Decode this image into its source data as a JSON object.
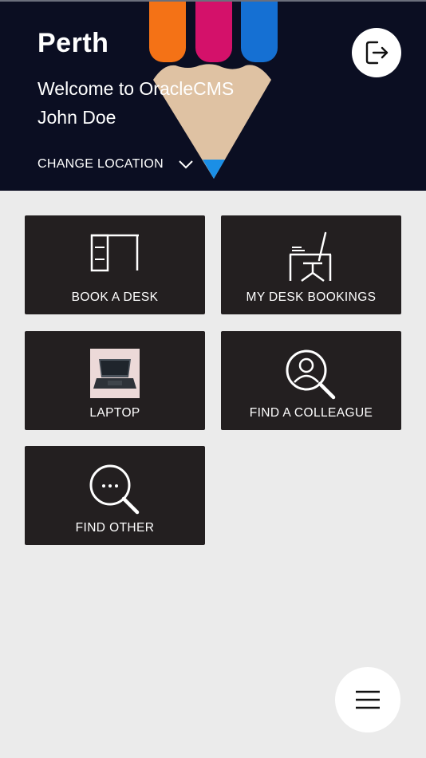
{
  "header": {
    "city": "Perth",
    "welcome": "Welcome to OracleCMS",
    "user_name": "John Doe",
    "change_location_label": "CHANGE LOCATION",
    "background_colors": {
      "dark": "#0b0e22",
      "orange": "#f47216",
      "magenta": "#d4116a",
      "blue": "#1570d3",
      "wood": "#dfc2a3"
    }
  },
  "tiles": [
    {
      "label": "BOOK A DESK",
      "icon": "desk-icon"
    },
    {
      "label": "MY DESK BOOKINGS",
      "icon": "desk-chair-icon"
    },
    {
      "label": "LAPTOP",
      "icon": "laptop-icon"
    },
    {
      "label": "FIND A COLLEAGUE",
      "icon": "person-search-icon"
    },
    {
      "label": "FIND OTHER",
      "icon": "more-search-icon"
    }
  ],
  "actions": {
    "logout_icon": "logout-icon",
    "menu_icon": "hamburger-menu-icon"
  },
  "colors": {
    "tile_bg": "#231f20",
    "page_bg": "#ebebeb",
    "fab_bg": "#ffffff"
  }
}
